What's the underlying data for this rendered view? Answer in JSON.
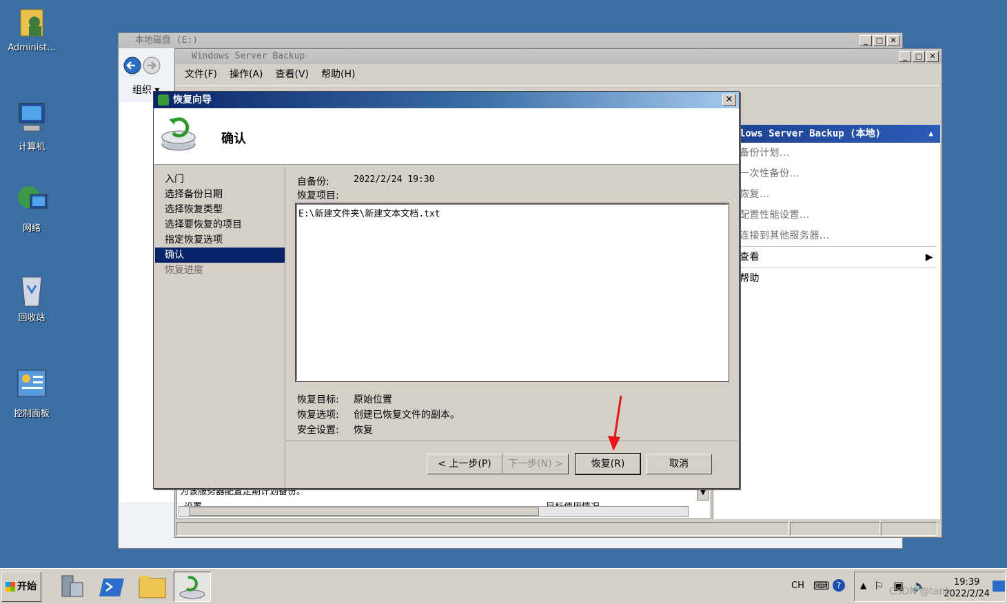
{
  "desktop": {
    "icons": [
      {
        "label": "Administ...",
        "icon": "user-folder-icon"
      },
      {
        "label": "计算机",
        "icon": "computer-icon"
      },
      {
        "label": "网络",
        "icon": "network-icon"
      },
      {
        "label": "回收站",
        "icon": "recycle-bin-icon"
      },
      {
        "label": "控制面板",
        "icon": "control-panel-icon"
      }
    ]
  },
  "explorer": {
    "title": "本地磁盘 (E:)",
    "organize_label": "组织"
  },
  "wsb": {
    "title": "Windows Server Backup",
    "menu": [
      "文件(F)",
      "操作(A)",
      "查看(V)",
      "帮助(H)"
    ],
    "actions_header": "lows Server Backup (本地)",
    "actions": [
      "备份计划...",
      "一次性备份...",
      "恢复...",
      "配置性能设置...",
      "连接到其他服务器..."
    ],
    "view_label": "查看",
    "help_label": "帮助",
    "bottom_text": "为该服务器配置定期计划备份。",
    "bottom_col1": "设置",
    "bottom_col2": "目标使用情况"
  },
  "wizard": {
    "title": "恢复向导",
    "heading": "确认",
    "steps": [
      "入门",
      "选择备份日期",
      "选择恢复类型",
      "选择要恢复的项目",
      "指定恢复选项",
      "确认",
      "恢复进度"
    ],
    "backup_label": "自备份:",
    "backup_value": "2022/2/24 19:30",
    "items_label": "恢复项目:",
    "items": [
      "E:\\新建文件夹\\新建文本文档.txt"
    ],
    "target_label": "恢复目标:",
    "target_value": "原始位置",
    "options_label": "恢复选项:",
    "options_value": "创建已恢复文件的副本。",
    "security_label": "安全设置:",
    "security_value": "恢复",
    "buttons": {
      "back": "< 上一步(P)",
      "next": "下一步(N) >",
      "recover": "恢复(R)",
      "cancel": "取消"
    }
  },
  "taskbar": {
    "start_label": "开始",
    "lang": "CH",
    "time": "19:39",
    "date": "2022/2/24"
  },
  "watermark": "CSDN @tanh"
}
